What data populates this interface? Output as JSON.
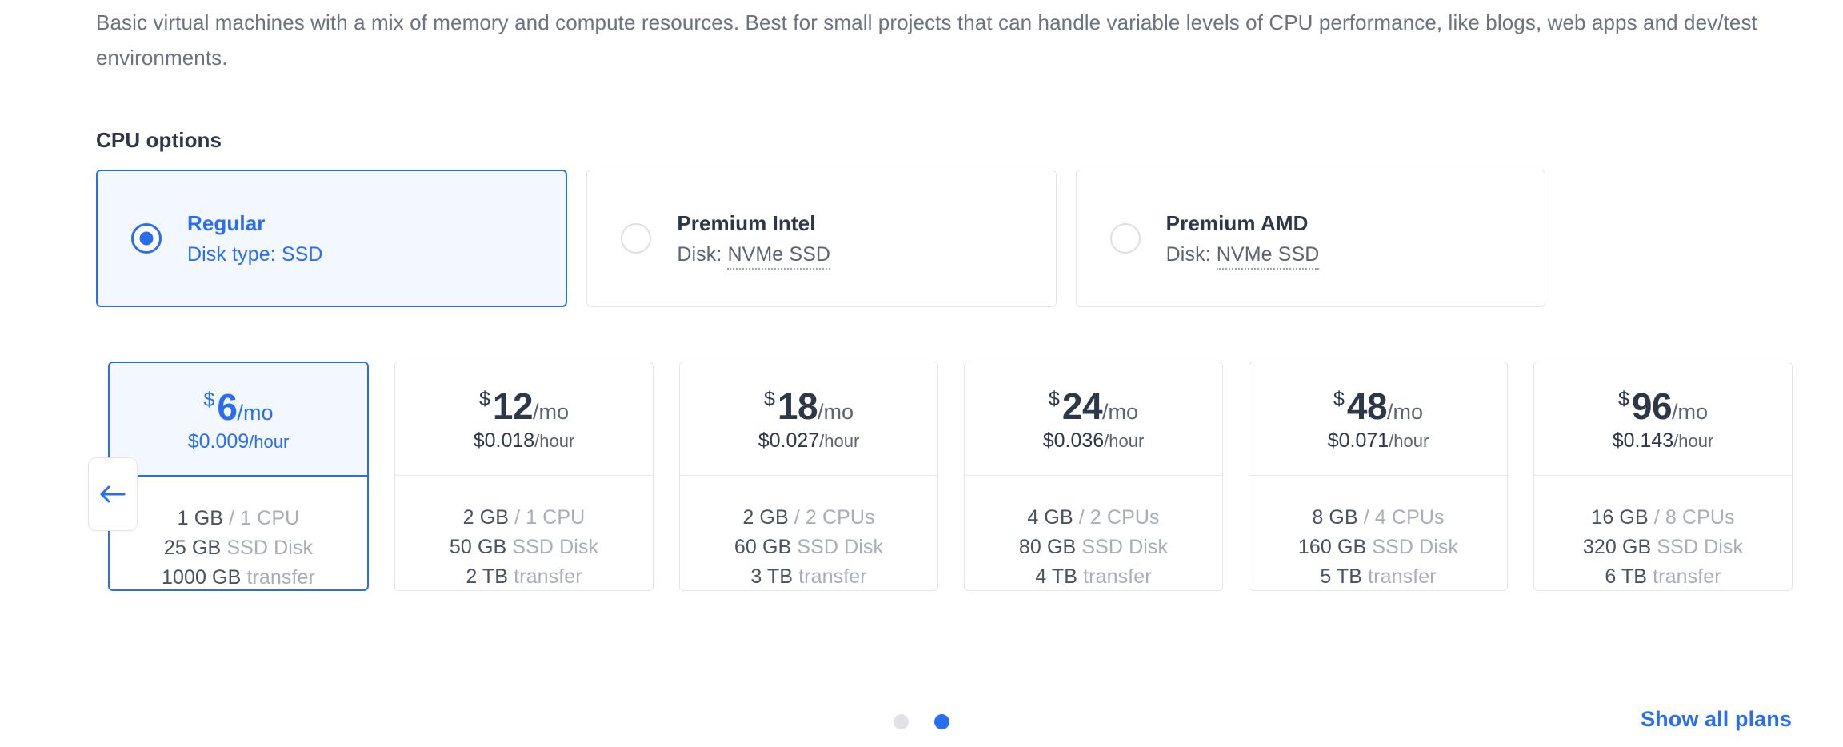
{
  "description": "Basic virtual machines with a mix of memory and compute resources. Best for small projects that can handle variable levels of CPU performance, like blogs, web apps and dev/test environments.",
  "cpu_options": {
    "title": "CPU options",
    "items": [
      {
        "name": "Regular",
        "sub_prefix": "Disk type: ",
        "sub_value": "SSD",
        "selected": true,
        "dotted": false
      },
      {
        "name": "Premium Intel",
        "sub_prefix": "Disk: ",
        "sub_value": "NVMe SSD",
        "selected": false,
        "dotted": true
      },
      {
        "name": "Premium AMD",
        "sub_prefix": "Disk: ",
        "sub_value": "NVMe SSD",
        "selected": false,
        "dotted": true
      }
    ]
  },
  "plans": [
    {
      "currency": "$",
      "amount": "6",
      "per": "/mo",
      "hourly_price": "$0.009",
      "hourly_unit": "/hour",
      "memory": "1 GB",
      "cpu": "1 CPU",
      "disk_size": "25 GB",
      "disk_label": "SSD Disk",
      "transfer_size": "1000 GB",
      "transfer_label": "transfer",
      "selected": true
    },
    {
      "currency": "$",
      "amount": "12",
      "per": "/mo",
      "hourly_price": "$0.018",
      "hourly_unit": "/hour",
      "memory": "2 GB",
      "cpu": "1 CPU",
      "disk_size": "50 GB",
      "disk_label": "SSD Disk",
      "transfer_size": "2 TB",
      "transfer_label": "transfer",
      "selected": false
    },
    {
      "currency": "$",
      "amount": "18",
      "per": "/mo",
      "hourly_price": "$0.027",
      "hourly_unit": "/hour",
      "memory": "2 GB",
      "cpu": "2 CPUs",
      "disk_size": "60 GB",
      "disk_label": "SSD Disk",
      "transfer_size": "3 TB",
      "transfer_label": "transfer",
      "selected": false
    },
    {
      "currency": "$",
      "amount": "24",
      "per": "/mo",
      "hourly_price": "$0.036",
      "hourly_unit": "/hour",
      "memory": "4 GB",
      "cpu": "2 CPUs",
      "disk_size": "80 GB",
      "disk_label": "SSD Disk",
      "transfer_size": "4 TB",
      "transfer_label": "transfer",
      "selected": false
    },
    {
      "currency": "$",
      "amount": "48",
      "per": "/mo",
      "hourly_price": "$0.071",
      "hourly_unit": "/hour",
      "memory": "8 GB",
      "cpu": "4 CPUs",
      "disk_size": "160 GB",
      "disk_label": "SSD Disk",
      "transfer_size": "5 TB",
      "transfer_label": "transfer",
      "selected": false
    },
    {
      "currency": "$",
      "amount": "96",
      "per": "/mo",
      "hourly_price": "$0.143",
      "hourly_unit": "/hour",
      "memory": "16 GB",
      "cpu": "8 CPUs",
      "disk_size": "320 GB",
      "disk_label": "SSD Disk",
      "transfer_size": "6 TB",
      "transfer_label": "transfer",
      "selected": false
    }
  ],
  "carousel": {
    "prev_icon": "arrow-left-icon",
    "dots": [
      {
        "active": false
      },
      {
        "active": true
      }
    ]
  },
  "footer": {
    "show_all_label": "Show all plans"
  },
  "colors": {
    "accent": "#2a6ef0",
    "accent_bg": "#f3f7ff",
    "border": "#e2e4e8",
    "muted_text": "#a8adb6",
    "body_text": "#4a5260",
    "dot_inactive": "#e0e2e5"
  }
}
